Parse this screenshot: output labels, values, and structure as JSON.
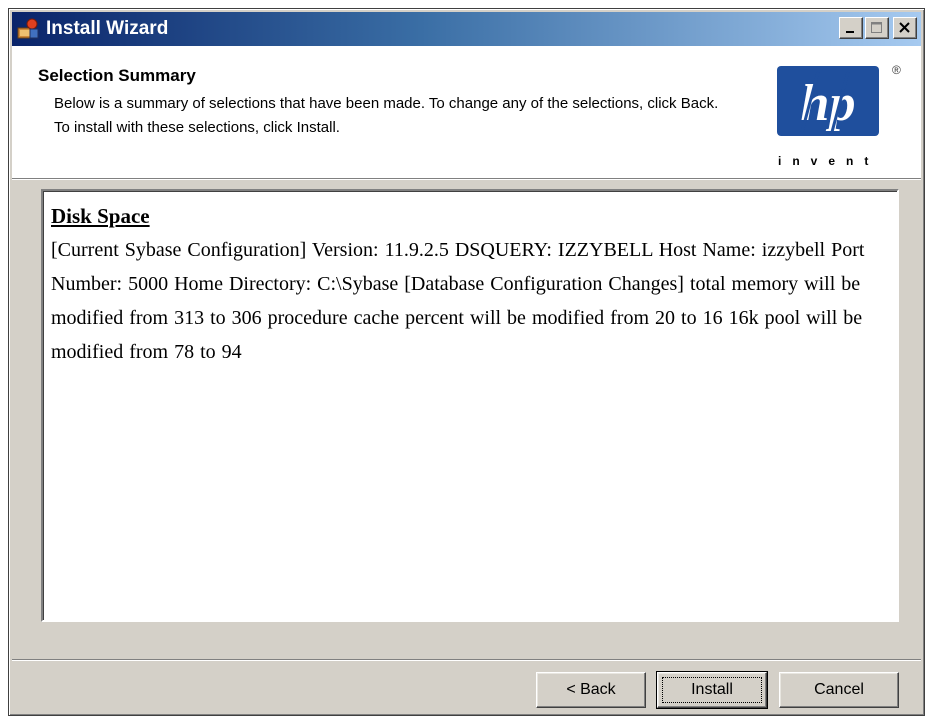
{
  "window": {
    "title": "Install Wizard",
    "icon": "installer-icon"
  },
  "header": {
    "title": "Selection Summary",
    "description": "Below is a summary of selections that have been made. To change any of the selections, click Back. To install with these selections, click Install.",
    "logo_text": "hp",
    "logo_tagline": "invent",
    "logo_mark": "®"
  },
  "summary": {
    "heading": "Disk Space",
    "body": "[Current Sybase Configuration] Version: 11.9.2.5 DSQUERY: IZZYBELL Host Name: izzybell Port Number: 5000 Home Directory: C:\\Sybase [Database Configuration Changes] total memory will be modified from 313 to 306 procedure cache percent will be modified from 20 to 16 16k pool will be modified from 78 to 94"
  },
  "buttons": {
    "back": "< Back",
    "install": "Install",
    "cancel": "Cancel"
  },
  "colors": {
    "titlebar_start": "#0a246a",
    "titlebar_end": "#a6caf0",
    "dialog_face": "#d4d0c8",
    "logo_blue": "#1f4f9d"
  }
}
